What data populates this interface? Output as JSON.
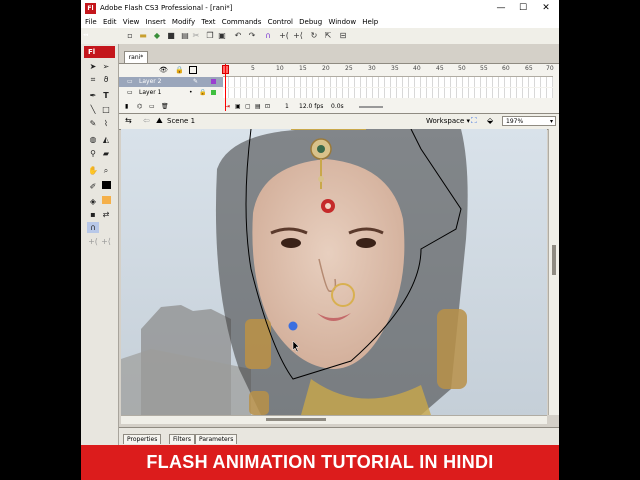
{
  "window": {
    "app_badge": "Fl",
    "title": "Adobe Flash CS3 Professional - [rani*]",
    "minimize_glyph": "—",
    "maximize_glyph": "☐",
    "close_glyph": "✕"
  },
  "menu": [
    "File",
    "Edit",
    "View",
    "Insert",
    "Modify",
    "Text",
    "Commands",
    "Control",
    "Debug",
    "Window",
    "Help"
  ],
  "tools_panel": {
    "collapse_label": "◂◂",
    "badge": "Fl"
  },
  "document": {
    "tab_label": "rani*"
  },
  "timeline": {
    "ruler_numbers": [
      "5",
      "10",
      "15",
      "20",
      "25",
      "30",
      "35",
      "40",
      "45",
      "50",
      "55",
      "60",
      "65",
      "70"
    ],
    "layers": [
      {
        "name": "Layer 2",
        "selected": true,
        "color": "#9b3fd1"
      },
      {
        "name": "Layer 1",
        "selected": false,
        "color": "#3fbf3f"
      }
    ],
    "current_frame": "1",
    "fps": "12.0 fps",
    "time": "0.0s"
  },
  "scene": {
    "label": "Scene 1",
    "workspace": "Workspace ▾",
    "zoom": "197%"
  },
  "properties_tabs": [
    "Properties",
    "Filters",
    "Parameters"
  ],
  "banner": {
    "text": "FLASH ANIMATION TUTORIAL IN HINDI",
    "color": "#dc1c1c"
  },
  "colors": {
    "flash_red": "#c4161c",
    "playhead": "#ff0000",
    "vertex_point": "#3a6fe0"
  }
}
